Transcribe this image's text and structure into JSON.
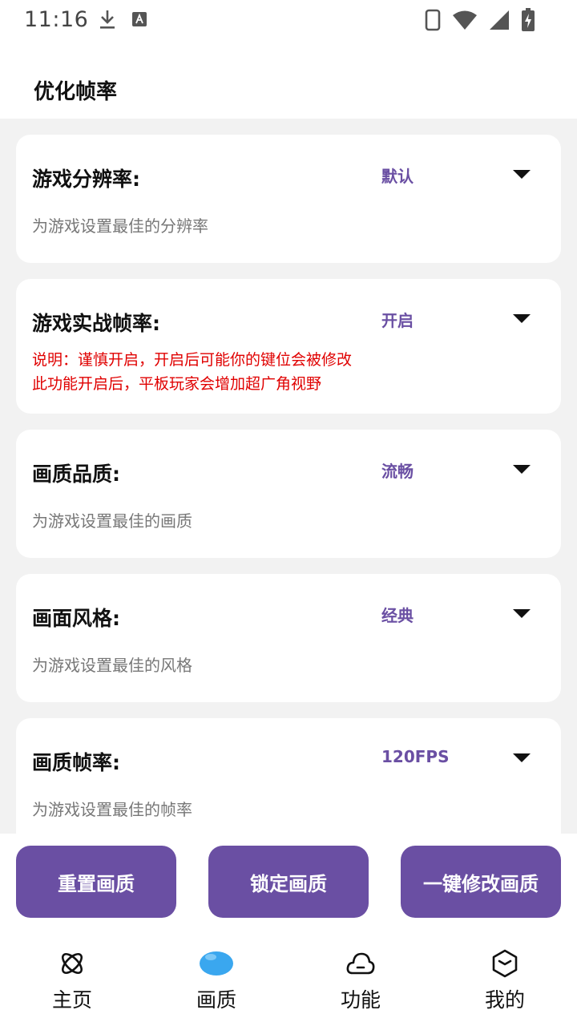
{
  "status_bar": {
    "time": "11:16"
  },
  "header": {
    "title": "优化帧率"
  },
  "settings": [
    {
      "title": "游戏分辨率:",
      "value": "默认",
      "description": "为游戏设置最佳的分辨率"
    },
    {
      "title": "游戏实战帧率:",
      "value": "开启",
      "note_lines": [
        "说明：谨慎开启，开启后可能你的键位会被修改",
        "此功能开启后，平板玩家会增加超广角视野"
      ]
    },
    {
      "title": "画质品质:",
      "value": "流畅",
      "description": "为游戏设置最佳的画质"
    },
    {
      "title": "画面风格:",
      "value": "经典",
      "description": "为游戏设置最佳的风格"
    },
    {
      "title": "画质帧率:",
      "value": "120FPS",
      "description": "为游戏设置最佳的帧率"
    }
  ],
  "actions": {
    "reset": "重置画质",
    "lock": "锁定画质",
    "one_click": "一键修改画质"
  },
  "tabs": [
    {
      "label": "主页",
      "icon": "atom-icon"
    },
    {
      "label": "画质",
      "icon": "blob-icon",
      "active": true
    },
    {
      "label": "功能",
      "icon": "cloud-icon"
    },
    {
      "label": "我的",
      "icon": "box-icon"
    }
  ],
  "colors": {
    "accent": "#6a4fa3",
    "warning": "#e00000",
    "active_tab": "#3aa7ef"
  }
}
